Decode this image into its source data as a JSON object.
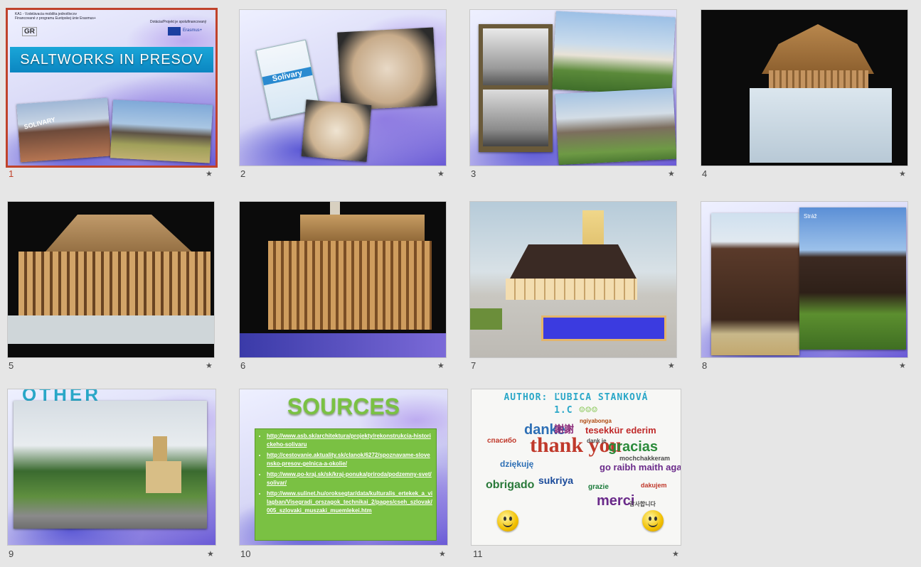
{
  "slides": [
    {
      "number": "1",
      "selected": true,
      "title": "SALTWORKS IN PRESOV",
      "header_lines": [
        "KA1 - Vzdelávacia mobilita jednotlivcov",
        "Financované z programu Európskej únie Erasmus+"
      ],
      "header_right": "Dotácia/Projekt je spolufinancovaný",
      "logo_text": "GR",
      "erasmus_label": "Erasmus+",
      "photo_sign": "SOLIVARY"
    },
    {
      "number": "2",
      "package_label": "Solivary"
    },
    {
      "number": "3"
    },
    {
      "number": "4"
    },
    {
      "number": "5"
    },
    {
      "number": "6"
    },
    {
      "number": "7"
    },
    {
      "number": "8",
      "photo_label": "Stráž"
    },
    {
      "number": "9",
      "title_fragment": "OTHER OBJECTS"
    },
    {
      "number": "10",
      "title": "SOURCES",
      "links": [
        "http://www.asb.sk/architektura/projekty/rekonstrukcia-historickeho-solivaru",
        "http://cestovanie.aktuality.sk/clanok/6272/spoznavame-slovensko-presov-gelnica-a-okolie/",
        "http://www.po-kraj.sk/sk/kraj-ponuka/priroda/podzemny-svet/solivar/",
        "http://www.sulinet.hu/oroksegtar/data/kulturalis_ertekek_a_vilagban/Visegradi_orszagok_technikai_2/pages/cseh_szlovak/005_szlovaki_muszaki_muemlekei.htm"
      ]
    },
    {
      "number": "11",
      "author": "AUTHOR: ĽUBICA STANKOVÁ",
      "class_label": "1.C",
      "cloud_words": [
        "danke",
        "謝謝",
        "tesekkür ederim",
        "ngiyabonga",
        "спасибо",
        "thank you",
        "gracias",
        "dziękuję",
        "go raibh maith agat",
        "obrigado",
        "sukriya",
        "merci",
        "mochchakkeram",
        "dank je",
        "grazie",
        "dakujem",
        "감사합니다"
      ]
    }
  ],
  "star_glyph": "★",
  "colors": {
    "selected_border": "#c0432b",
    "background": "#e6e6e6",
    "sources_green": "#7ac143",
    "author_teal": "#2aa7c8"
  }
}
